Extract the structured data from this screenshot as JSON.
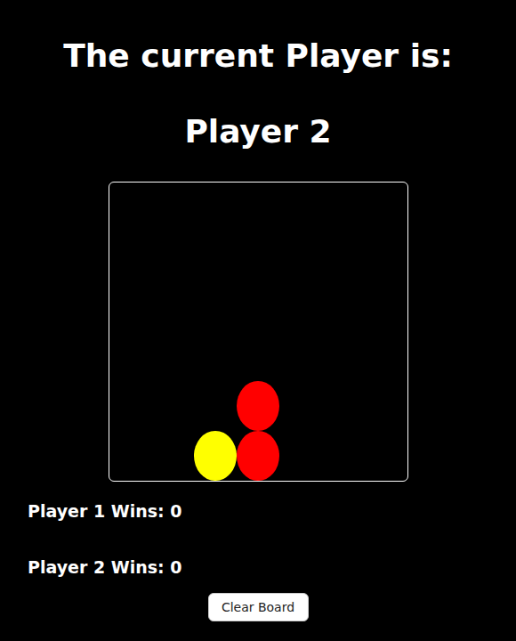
{
  "status": {
    "label": "The current Player is:",
    "player": "Player 2"
  },
  "board": {
    "cells": [
      [
        null,
        null,
        null,
        null,
        null,
        null,
        null
      ],
      [
        null,
        null,
        null,
        null,
        null,
        null,
        null
      ],
      [
        null,
        null,
        null,
        null,
        null,
        null,
        null
      ],
      [
        null,
        null,
        null,
        null,
        null,
        null,
        null
      ],
      [
        null,
        null,
        null,
        "#ff0000",
        null,
        null,
        null
      ],
      [
        null,
        null,
        "#ffff00",
        "#ff0000",
        null,
        null,
        null
      ]
    ]
  },
  "scores": [
    {
      "label": "Player 1 Wins: 0"
    },
    {
      "label": "Player 2 Wins: 0"
    }
  ],
  "buttons": [
    "Clear Board"
  ]
}
